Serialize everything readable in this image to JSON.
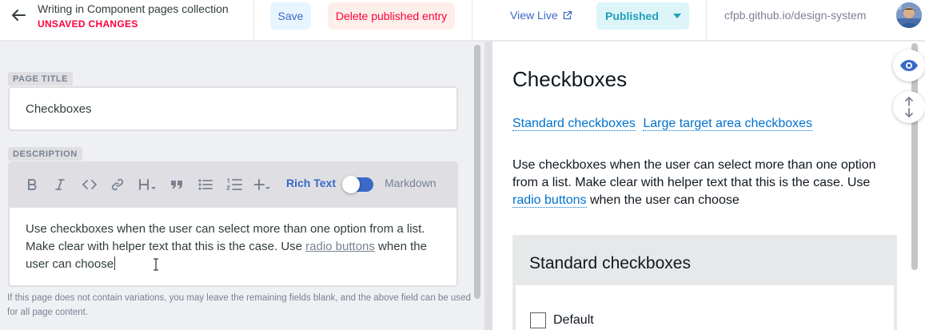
{
  "header": {
    "collection_title": "Writing in Component pages collection",
    "status": "UNSAVED CHANGES",
    "save_label": "Save",
    "delete_label": "Delete published entry",
    "view_live_label": "View Live",
    "published_label": "Published",
    "site_url": "cfpb.github.io/design-system"
  },
  "editor": {
    "page_title_label": "PAGE TITLE",
    "page_title_value": "Checkboxes",
    "description_label": "DESCRIPTION",
    "toolbar": {
      "icons": [
        "bold-icon",
        "italic-icon",
        "code-icon",
        "link-icon",
        "heading-icon",
        "quote-icon",
        "bulleted-list-icon",
        "numbered-list-icon",
        "add-component-icon"
      ],
      "rich_text_label": "Rich Text",
      "markdown_label": "Markdown",
      "rich_text_enabled": true
    },
    "description": {
      "text_before": "Use checkboxes when the user can select more than one option from a list. Make clear with helper text that this is the case. Use ",
      "link_text": "radio buttons",
      "text_after": " when the user can choose"
    },
    "hint": "If this page does not contain variations, you may leave the remaining fields blank, and the above field can be used for all page content."
  },
  "preview": {
    "title": "Checkboxes",
    "links": [
      "Standard checkboxes",
      "Large target area checkboxes"
    ],
    "para_before": "Use checkboxes when the user can select more than one option from a list. Make clear with helper text that this is the case. Use ",
    "para_link": "radio buttons",
    "para_after": " when the user can choose",
    "section_title": "Standard checkboxes",
    "checkbox_label": "Default",
    "checkbox_checked": false
  },
  "icons": {
    "back": "arrow-left-icon",
    "external": "external-link-icon",
    "preview_toggle": "eye-icon",
    "sync_scroll": "sync-scroll-icon"
  },
  "colors": {
    "accent": "#3a69c7",
    "danger": "#ff003b",
    "published": "#1f9fbb",
    "link": "#0072ce"
  }
}
